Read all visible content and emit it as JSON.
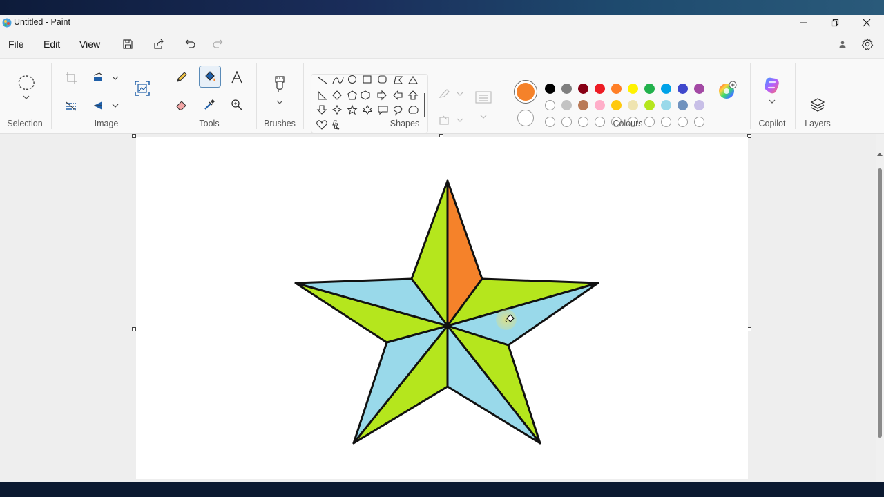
{
  "window": {
    "title": "Untitled - Paint"
  },
  "menu": {
    "file": "File",
    "edit": "Edit",
    "view": "View"
  },
  "groups": {
    "selection": "Selection",
    "image": "Image",
    "tools": "Tools",
    "brushes": "Brushes",
    "shapes": "Shapes",
    "colours": "Colours",
    "copilot": "Copilot",
    "layers": "Layers"
  },
  "tools": {
    "active": "fill-tool"
  },
  "colours": {
    "primary": "#f5822a",
    "secondary": "#ffffff",
    "row1": [
      "#000000",
      "#7f7f7f",
      "#880015",
      "#ed1c24",
      "#ff7f27",
      "#fff200",
      "#22b14c",
      "#00a2e8",
      "#3f48cc",
      "#a349a4"
    ],
    "row2": [
      "#ffffff",
      "#c3c3c3",
      "#b97a57",
      "#ffaec9",
      "#ffc90e",
      "#efe4b0",
      "#b5e61d",
      "#99d9ea",
      "#7092be",
      "#c8bfe7"
    ],
    "row3_empty_count": 10
  },
  "drawing": {
    "description_colors": {
      "green": "#b5e61d",
      "blue": "#99d9ea",
      "orange": "#f5822a",
      "outline": "#111111"
    }
  }
}
